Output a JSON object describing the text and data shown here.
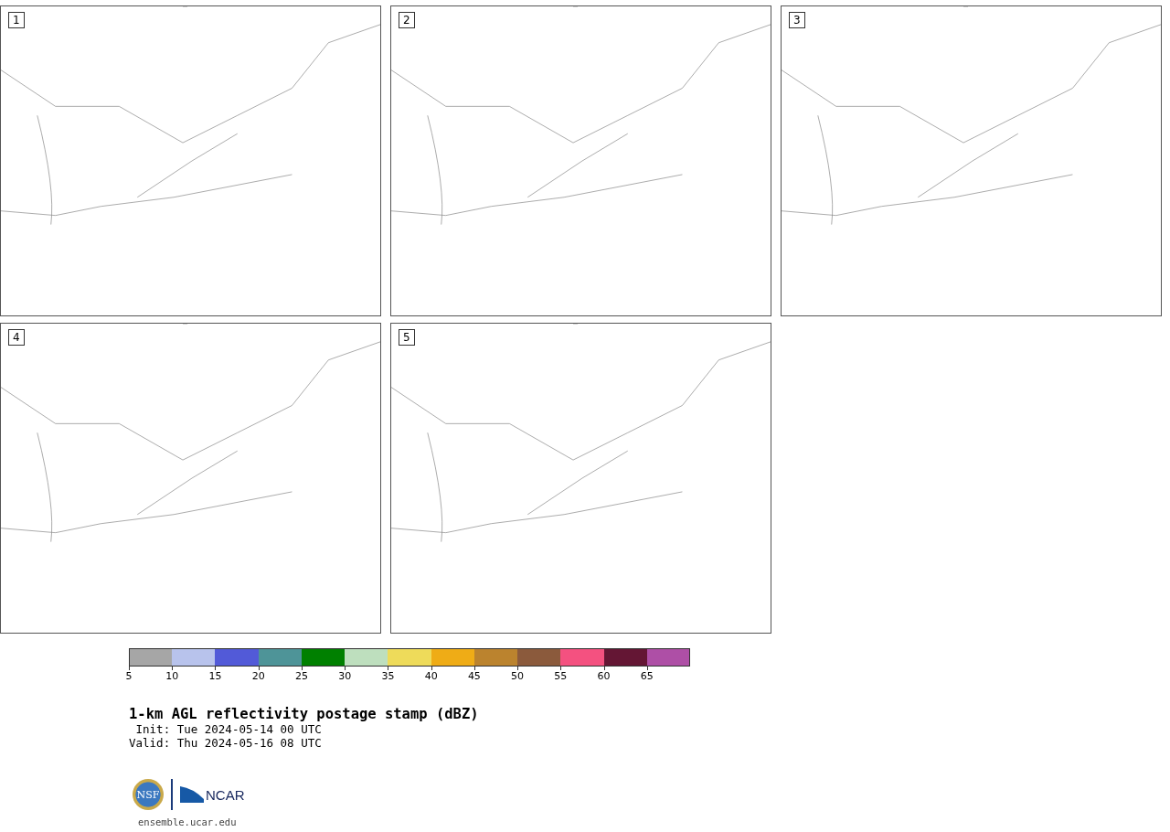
{
  "panels": [
    {
      "label": "1"
    },
    {
      "label": "2"
    },
    {
      "label": "3"
    },
    {
      "label": "4"
    },
    {
      "label": "5"
    }
  ],
  "colorbar": {
    "segments": [
      {
        "color": "#a6a6a6",
        "tick": "5"
      },
      {
        "color": "#b8c3ec",
        "tick": "10"
      },
      {
        "color": "#525ad8",
        "tick": "15"
      },
      {
        "color": "#4e9498",
        "tick": "20"
      },
      {
        "color": "#008000",
        "tick": "25"
      },
      {
        "color": "#bedfbe",
        "tick": "30"
      },
      {
        "color": "#eedb5a",
        "tick": "35"
      },
      {
        "color": "#efac16",
        "tick": "40"
      },
      {
        "color": "#bb832e",
        "tick": "45"
      },
      {
        "color": "#8b5a3c",
        "tick": "50"
      },
      {
        "color": "#f45180",
        "tick": "55"
      },
      {
        "color": "#641634",
        "tick": "60"
      },
      {
        "color": "#ae4fa6",
        "tick": "65"
      }
    ]
  },
  "title": "1-km AGL reflectivity postage stamp (dBZ)",
  "init": " Init: Tue 2024-05-14 00 UTC",
  "valid": "Valid: Thu 2024-05-16 08 UTC",
  "logos": {
    "nsf": "NSF",
    "ncar": "NCAR"
  },
  "footer": "ensemble.ucar.edu"
}
